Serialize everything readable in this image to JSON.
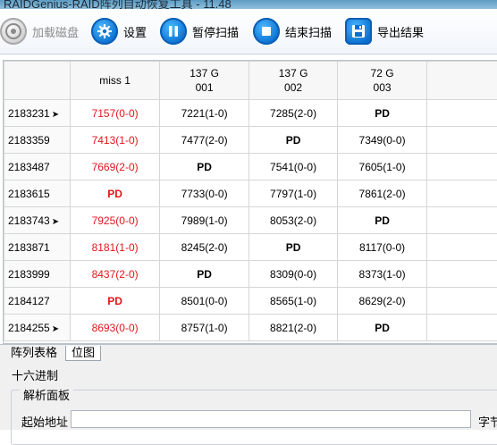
{
  "window": {
    "title": "RAIDGenius-RAID阵列自动恢复工具 - 11.48"
  },
  "toolbar": {
    "load_disk": "加载磁盘",
    "settings": "设置",
    "pause_scan": "暂停扫描",
    "stop_scan": "结束扫描",
    "export": "导出结果"
  },
  "grid": {
    "columns": [
      {
        "line1": "miss 1",
        "line2": ""
      },
      {
        "line1": "137 G",
        "line2": "001"
      },
      {
        "line1": "137 G",
        "line2": "002"
      },
      {
        "line1": "72 G",
        "line2": "003"
      }
    ],
    "rows": [
      {
        "label": "2183231",
        "marker": "➤",
        "cells": [
          "7157(0-0)",
          "7221(1-0)",
          "7285(2-0)",
          "PD"
        ]
      },
      {
        "label": "2183359",
        "marker": "",
        "cells": [
          "7413(1-0)",
          "7477(2-0)",
          "PD",
          "7349(0-0)"
        ]
      },
      {
        "label": "2183487",
        "marker": "",
        "cells": [
          "7669(2-0)",
          "PD",
          "7541(0-0)",
          "7605(1-0)"
        ]
      },
      {
        "label": "2183615",
        "marker": "",
        "cells": [
          "PD",
          "7733(0-0)",
          "7797(1-0)",
          "7861(2-0)"
        ]
      },
      {
        "label": "2183743",
        "marker": "➤",
        "cells": [
          "7925(0-0)",
          "7989(1-0)",
          "8053(2-0)",
          "PD"
        ]
      },
      {
        "label": "2183871",
        "marker": "",
        "cells": [
          "8181(1-0)",
          "8245(2-0)",
          "PD",
          "8117(0-0)"
        ]
      },
      {
        "label": "2183999",
        "marker": "",
        "cells": [
          "8437(2-0)",
          "PD",
          "8309(0-0)",
          "8373(1-0)"
        ]
      },
      {
        "label": "2184127",
        "marker": "",
        "cells": [
          "PD",
          "8501(0-0)",
          "8565(1-0)",
          "8629(2-0)"
        ]
      },
      {
        "label": "2184255",
        "marker": "➤",
        "cells": [
          "8693(0-0)",
          "8757(1-0)",
          "8821(2-0)",
          "PD"
        ]
      }
    ]
  },
  "tabs": {
    "array_table": "阵列表格",
    "bitmap": "位图"
  },
  "hex": {
    "title": "十六进制",
    "parse_panel": "解析面板",
    "start_address_label": "起始地址",
    "start_address_value": "",
    "right_label": "字节"
  },
  "colors": {
    "miss_column_text": "#e0161b",
    "accent_blue": "#0a6fd0"
  },
  "icons": {
    "load_disk": "disk-icon",
    "settings": "gear-icon",
    "pause_scan": "pause-icon",
    "stop_scan": "stop-icon",
    "export": "floppy-save-icon"
  }
}
